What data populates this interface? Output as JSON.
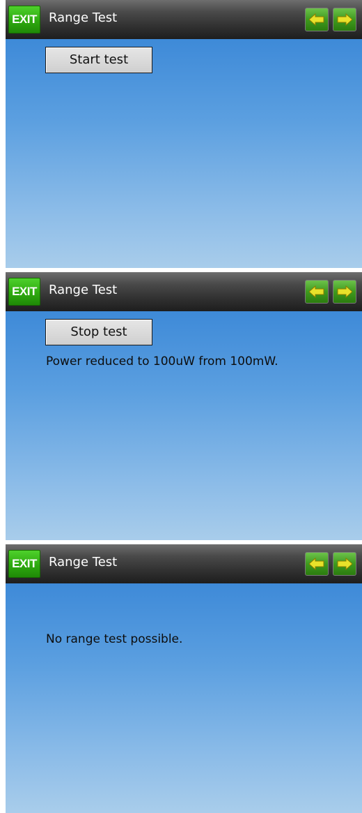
{
  "screens": [
    {
      "header": {
        "exit_label": "EXIT",
        "title": "Range Test"
      },
      "button_label": "Start test",
      "message": ""
    },
    {
      "header": {
        "exit_label": "EXIT",
        "title": "Range Test"
      },
      "button_label": "Stop test",
      "message": "Power reduced to 100uW from 100mW."
    },
    {
      "header": {
        "exit_label": "EXIT",
        "title": "Range Test"
      },
      "button_label": "",
      "message": "No range test possible."
    }
  ],
  "icons": {
    "prev": "arrow-left-icon",
    "next": "arrow-right-icon"
  },
  "colors": {
    "exit_green": "#2ea90f",
    "nav_green": "#3f9a1f",
    "arrow_yellow": "#e8e22a",
    "content_blue": "#5b9fe0"
  }
}
